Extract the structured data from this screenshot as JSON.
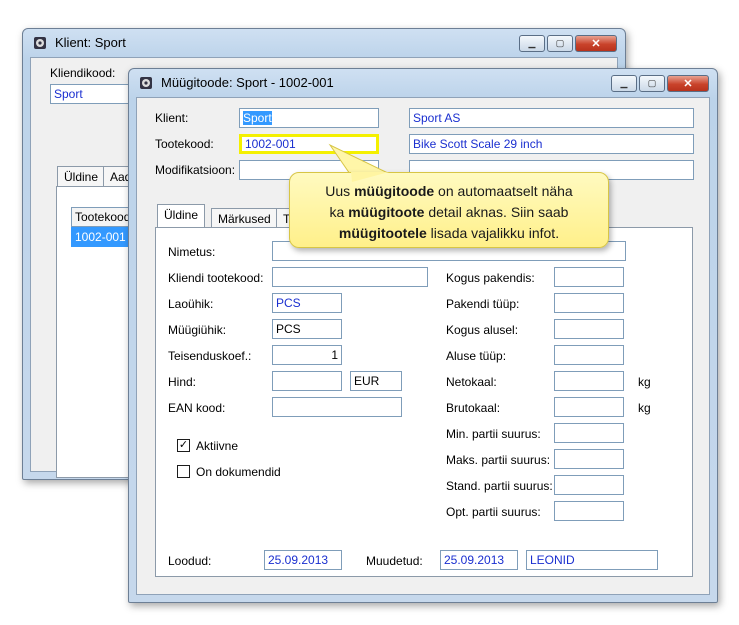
{
  "back_window": {
    "title": "Klient: Sport",
    "client_code_label": "Kliendikood:",
    "client_code_value": "Sport",
    "tabs": [
      "Üldine",
      "Aad"
    ],
    "list_header": "Tootekood",
    "list_row": "1002-001"
  },
  "front_window": {
    "title": "Müügitoode: Sport - 1002-001",
    "client_label": "Klient:",
    "client_code": "Sport",
    "client_name": "Sport AS",
    "product_code_label": "Tootekood:",
    "product_code": "1002-001",
    "product_name": "Bike Scott Scale 29 inch",
    "modification_label": "Modifikatsioon:",
    "tabs": [
      "Üldine",
      "Märkused",
      "T"
    ],
    "left_fields": {
      "name_label": "Nimetus:",
      "client_product_code_label": "Kliendi tootekood:",
      "stock_unit_label": "Laoühik:",
      "stock_unit_value": "PCS",
      "sales_unit_label": "Müügiühik:",
      "sales_unit_value": "PCS",
      "conversion_label": "Teisenduskoef.:",
      "conversion_value": "1",
      "price_label": "Hind:",
      "currency_value": "EUR",
      "ean_label": "EAN kood:"
    },
    "right_fields": {
      "qty_package_label": "Kogus pakendis:",
      "package_type_label": "Pakendi tüüp:",
      "qty_pallet_label": "Kogus alusel:",
      "pallet_type_label": "Aluse tüüp:",
      "net_weight_label": "Netokaal:",
      "gross_weight_label": "Brutokaal:",
      "weight_unit": "kg",
      "min_batch_label": "Min. partii suurus:",
      "max_batch_label": "Maks. partii suurus:",
      "std_batch_label": "Stand. partii suurus:",
      "opt_batch_label": "Opt. partii suurus:"
    },
    "active_label": "Aktiivne",
    "active_checked": "✓",
    "on_documents_label": "On dokumendid",
    "created_label": "Loodud:",
    "created_value": "25.09.2013",
    "modified_label": "Muudetud:",
    "modified_value": "25.09.2013",
    "modified_by": "LEONID"
  },
  "callout": {
    "line1_pre": "Uus ",
    "line1_bold": "müügitoode",
    "line1_post": " on automaatselt näha",
    "line2_pre": "ka ",
    "line2_bold": "müügitoote",
    "line2_post": " detail aknas. Siin saab",
    "line3_bold": "müügitootele",
    "line3_post": " lisada vajalikku infot."
  },
  "icons": {
    "window": "gear-app-icon",
    "minimize": "minimize-icon",
    "maximize": "maximize-icon",
    "close": "close-icon"
  },
  "colors": {
    "field_value_blue": "#1a2fd0",
    "highlight_yellow": "#ffff00",
    "callout_fill": "#fff4a0"
  }
}
